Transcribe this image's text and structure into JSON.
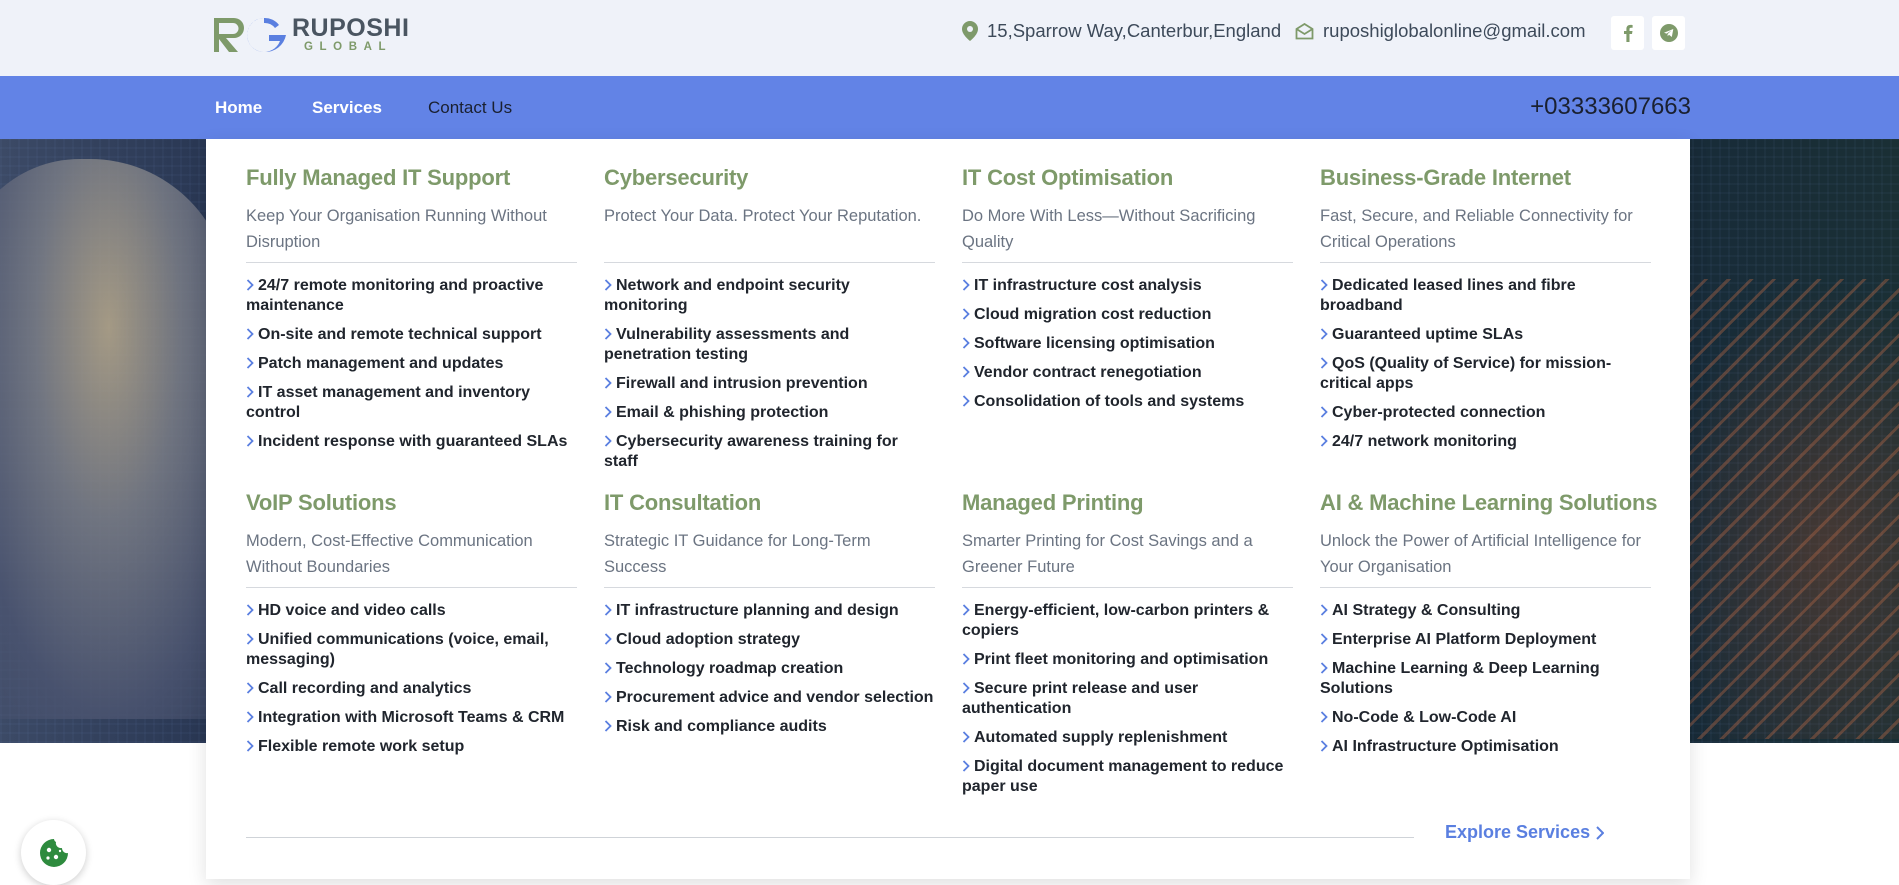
{
  "brand": {
    "name": "RUPOSHI",
    "sub": "GLOBAL"
  },
  "topbar": {
    "address": "15,Sparrow Way,Canterbur,England",
    "email": "ruposhiglobalonline@gmail.com",
    "icons": {
      "address": "location-pin-icon",
      "email": "envelope-icon",
      "social": [
        "facebook-icon",
        "telegram-icon"
      ]
    }
  },
  "nav": {
    "items": [
      "Home",
      "Services",
      "Contact Us"
    ],
    "phone": "+03333607663"
  },
  "colors": {
    "nav_bg": "#6283e6",
    "heading": "#7e9a6a",
    "accent": "#5a7fe0",
    "topbar_bg": "#eff2f9"
  },
  "services": [
    {
      "title": "Fully Managed IT Support",
      "subtitle": "Keep Your Organisation Running Without Disruption",
      "items": [
        "24/7 remote monitoring and proactive maintenance",
        "On-site and remote technical support",
        "Patch management and updates",
        "IT asset management and inventory control",
        "Incident response with guaranteed SLAs"
      ]
    },
    {
      "title": "Cybersecurity",
      "subtitle": "Protect Your Data. Protect Your Reputation.",
      "items": [
        "Network and endpoint security monitoring",
        "Vulnerability assessments and penetration testing",
        "Firewall and intrusion prevention",
        "Email & phishing protection",
        "Cybersecurity awareness training for staff"
      ]
    },
    {
      "title": "IT Cost Optimisation",
      "subtitle": "Do More With Less—Without Sacrificing Quality",
      "items": [
        "IT infrastructure cost analysis",
        "Cloud migration cost reduction",
        "Software licensing optimisation",
        "Vendor contract renegotiation",
        "Consolidation of tools and systems"
      ]
    },
    {
      "title": "Business-Grade Internet",
      "subtitle": "Fast, Secure, and Reliable Connectivity for Critical Operations",
      "items": [
        "Dedicated leased lines and fibre broadband",
        "Guaranteed uptime SLAs",
        "QoS (Quality of Service) for mission-critical apps",
        "Cyber-protected connection",
        "24/7 network monitoring"
      ]
    },
    {
      "title": "VoIP Solutions",
      "subtitle": "Modern, Cost-Effective Communication Without Boundaries",
      "items": [
        "HD voice and video calls",
        "Unified communications (voice, email, messaging)",
        "Call recording and analytics",
        "Integration with Microsoft Teams & CRM",
        "Flexible remote work setup"
      ]
    },
    {
      "title": "IT Consultation",
      "subtitle": "Strategic IT Guidance for Long-Term Success",
      "items": [
        "IT infrastructure planning and design",
        "Cloud adoption strategy",
        "Technology roadmap creation",
        "Procurement advice and vendor selection",
        "Risk and compliance audits"
      ]
    },
    {
      "title": "Managed Printing",
      "subtitle": "Smarter Printing for Cost Savings and a Greener Future",
      "items": [
        "Energy-efficient, low-carbon printers & copiers",
        "Print fleet monitoring and optimisation",
        "Secure print release and user authentication",
        "Automated supply replenishment",
        "Digital document management to reduce paper use"
      ]
    },
    {
      "title": "AI & Machine Learning Solutions",
      "subtitle": "Unlock the Power of Artificial Intelligence for Your Organisation",
      "items": [
        "AI Strategy & Consulting",
        "Enterprise AI Platform Deployment",
        "Machine Learning & Deep Learning Solutions",
        "No-Code & Low-Code AI",
        "AI Infrastructure Optimisation"
      ]
    }
  ],
  "explore": {
    "label": "Explore Services",
    "icon": "chevron-right-icon"
  },
  "cookie": {
    "icon": "cookie-icon"
  }
}
